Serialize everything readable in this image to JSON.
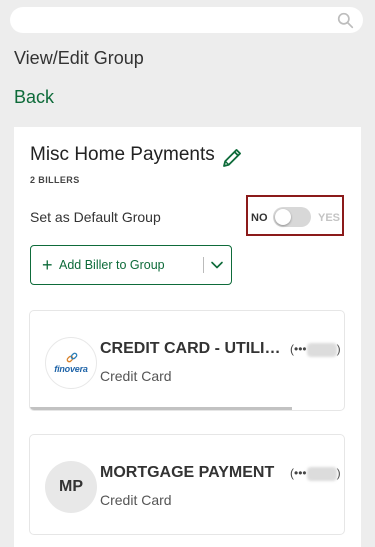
{
  "search": {
    "value": "",
    "placeholder": ""
  },
  "header": {
    "title": "View/Edit Group",
    "back_label": "Back"
  },
  "group": {
    "name": "Misc Home Payments",
    "billers_count": "2 BILLERS",
    "default_label": "Set as Default Group",
    "default_toggle": {
      "off_label": "NO",
      "on_label": "YES",
      "is_on": false
    },
    "add_biller_label": "Add Biller to Group"
  },
  "billers": [
    {
      "name": "CREDIT CARD - UTILITI...",
      "account_prefix": "(•••",
      "account_suffix": ")",
      "type": "Credit Card",
      "logo": {
        "kind": "image",
        "brand_text": "finovera",
        "icon": "chain-link-icon"
      }
    },
    {
      "name": "MORTGAGE PAYMENT",
      "account_prefix": "(•••",
      "account_suffix": ")",
      "type": "Credit Card",
      "logo": {
        "kind": "initials",
        "initials": "MP"
      }
    }
  ],
  "icons": {
    "search": "search-icon",
    "edit": "pencil-icon",
    "add": "plus-icon",
    "dropdown": "chevron-down-icon"
  },
  "colors": {
    "brand_green": "#0e6b3a",
    "highlight_border": "#8b1a1a",
    "page_background": "#ededed"
  }
}
